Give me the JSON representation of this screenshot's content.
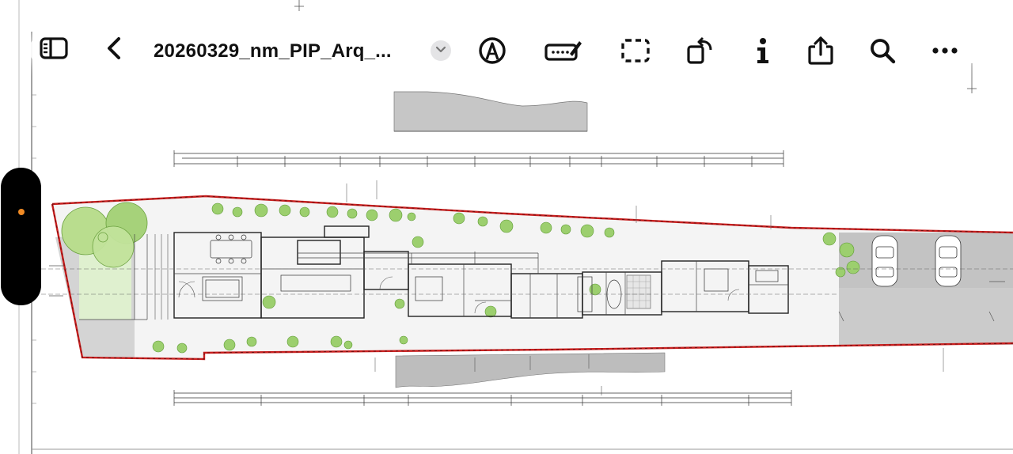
{
  "document": {
    "title": "20260329_nm_PIP_Arq_...",
    "title_menu_icon": "chevron-down-icon"
  },
  "toolbar": {
    "left": [
      {
        "name": "sidebar-toggle-button",
        "icon": "sidebar-icon"
      },
      {
        "name": "back-button",
        "icon": "chevron-left-icon"
      }
    ],
    "markup_group": [
      {
        "name": "markup-button",
        "icon": "pen-circle-icon"
      },
      {
        "name": "signature-button",
        "icon": "signature-icon"
      },
      {
        "name": "select-button",
        "icon": "dashed-rectangle-icon"
      },
      {
        "name": "rotate-button",
        "icon": "rotate-icon"
      }
    ],
    "actions_group": [
      {
        "name": "info-button",
        "icon": "info-icon"
      },
      {
        "name": "share-button",
        "icon": "share-icon"
      },
      {
        "name": "search-button",
        "icon": "magnifier-icon"
      },
      {
        "name": "more-button",
        "icon": "ellipsis-icon"
      }
    ]
  },
  "side_handle": {
    "indicator_color": "#f08a24"
  },
  "colors": {
    "plot_boundary": "#c81e1e",
    "vegetation": "#a9d67c",
    "paving": "#c9c9c9",
    "pill_background": "#ffffff",
    "icon": "#111111"
  }
}
